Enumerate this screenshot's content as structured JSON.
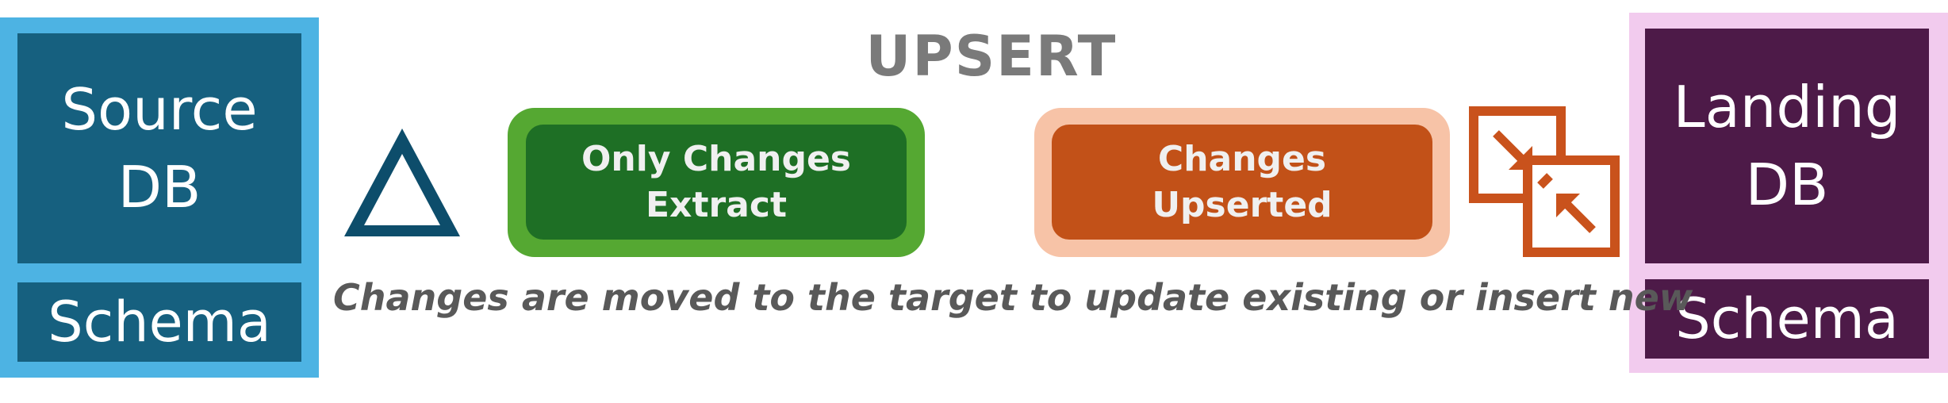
{
  "title": "UPSERT",
  "source": {
    "db_label": "Source\nDB",
    "schema_label": "Schema"
  },
  "landing": {
    "db_label": "Landing\nDB",
    "schema_label": "Schema"
  },
  "steps": {
    "extract_label": "Only Changes\nExtract",
    "upsert_label": "Changes\nUpserted"
  },
  "caption": "Changes are moved to the target to update existing or insert new",
  "icons": {
    "delta": "delta-icon",
    "merge": "merge-arrows-icon"
  },
  "colors": {
    "source_border": "#4db3e3",
    "source_fill": "#16607f",
    "landing_border": "#f2cbee",
    "landing_fill": "#4d1a48",
    "extract_border": "#55a832",
    "extract_fill": "#1e6f25",
    "upsert_border": "#f7c3a7",
    "upsert_fill": "#c25118"
  }
}
